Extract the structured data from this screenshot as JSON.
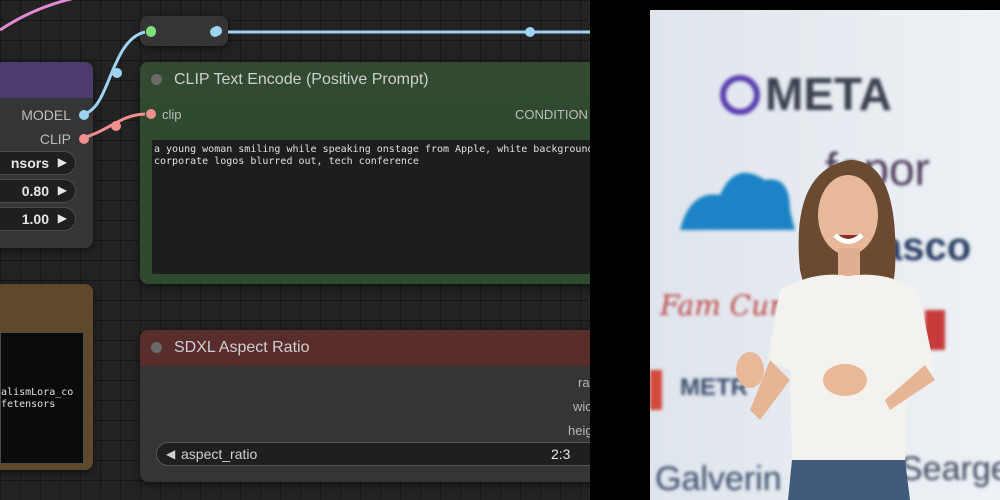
{
  "lora_node": {
    "outputs": {
      "model": "MODEL",
      "clip": "CLIP"
    },
    "widgets": [
      {
        "value": "nsors"
      },
      {
        "value": "0.80"
      },
      {
        "value": "1.00"
      }
    ]
  },
  "checkpoint_node": {
    "text_lines": [
      "RealismLora_co",
      "safetensors"
    ]
  },
  "clip_node": {
    "title": "CLIP Text Encode (Positive Prompt)",
    "input_label": "clip",
    "output_label": "CONDITION",
    "prompt_lines": [
      "a young woman smiling while speaking onstage from Apple, white background w",
      "corporate logos blurred out, tech conference"
    ]
  },
  "sdxl_node": {
    "title": "SDXL Aspect Ratio",
    "outputs": [
      "ra",
      "wic",
      "heig"
    ],
    "aspect_ratio_label": "aspect_ratio",
    "aspect_ratio_value": "2:3"
  },
  "photo": {
    "logos": [
      "META",
      "fopor",
      "asco",
      "Fam Cura",
      "METR",
      "Galverin",
      "Seargen"
    ]
  },
  "colors": {
    "wire_blue": "#9ed3f2",
    "wire_pink": "#f28f8f",
    "wire_magenta": "#e08ad6",
    "green_node": "#2f4a2e",
    "red_header": "#5a2d2d",
    "purple_header": "#4d3b6e"
  }
}
